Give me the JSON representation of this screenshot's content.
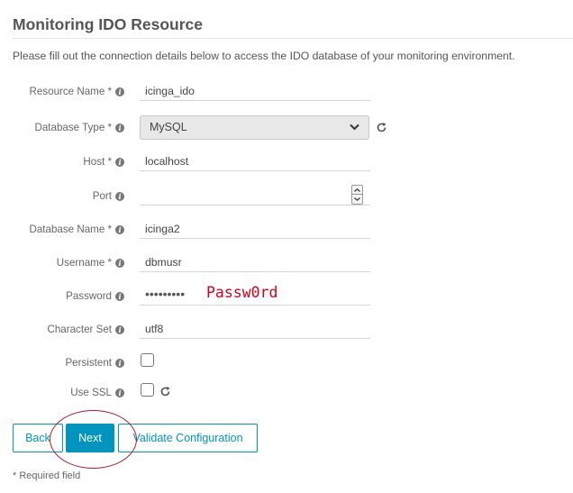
{
  "header": {
    "title": "Monitoring IDO Resource",
    "intro": "Please fill out the connection details below to access the IDO database of your monitoring environment."
  },
  "form": {
    "resource_name": {
      "label": "Resource Name *",
      "value": "icinga_ido"
    },
    "database_type": {
      "label": "Database Type *",
      "value": "MySQL"
    },
    "host": {
      "label": "Host *",
      "value": "localhost"
    },
    "port": {
      "label": "Port",
      "value": ""
    },
    "database_name": {
      "label": "Database Name *",
      "value": "icinga2"
    },
    "username": {
      "label": "Username *",
      "value": "dbmusr"
    },
    "password": {
      "label": "Password",
      "masked": "•••••••••",
      "annotation": "Passw0rd"
    },
    "character_set": {
      "label": "Character Set",
      "value": "utf8"
    },
    "persistent": {
      "label": "Persistent",
      "checked": false
    },
    "use_ssl": {
      "label": "Use SSL",
      "checked": false
    }
  },
  "buttons": {
    "back": "Back",
    "next": "Next",
    "validate": "Validate Configuration"
  },
  "footer": {
    "required_note": "* Required field"
  },
  "icons": {
    "info": "info-icon",
    "refresh": "refresh-icon",
    "dropdown": "chevron-down-icon"
  },
  "colors": {
    "accent": "#0095bf",
    "annotation": "#d0021b",
    "highlight_ring": "#b01c2e"
  }
}
